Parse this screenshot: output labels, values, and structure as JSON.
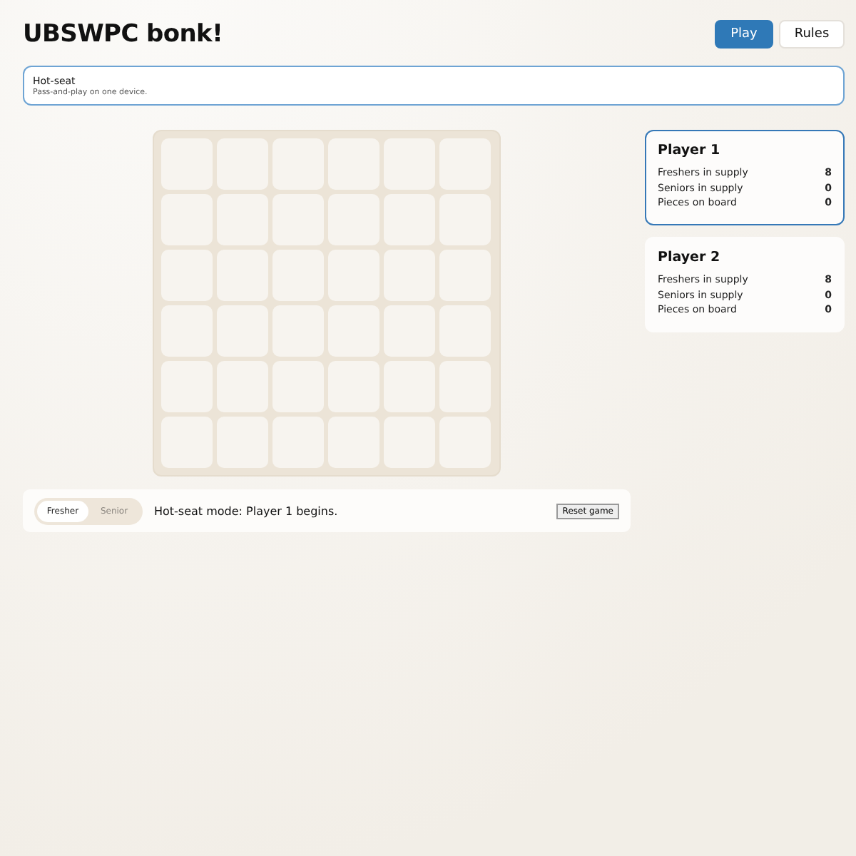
{
  "title": "UBSWPC bonk!",
  "nav": [
    {
      "label": "Play",
      "selected": true
    },
    {
      "label": "Rules",
      "selected": false
    }
  ],
  "mode": {
    "title": "Hot-seat",
    "description": "Pass-and-play on one device.",
    "selected": true
  },
  "board": {
    "rows": [
      [
        {
          "kind": "empty"
        },
        {
          "kind": "empty"
        },
        {
          "kind": "empty"
        },
        {
          "kind": "empty"
        },
        {
          "kind": "empty"
        },
        {
          "kind": "empty"
        }
      ],
      [
        {
          "kind": "empty"
        },
        {
          "kind": "empty"
        },
        {
          "kind": "empty"
        },
        {
          "kind": "empty"
        },
        {
          "kind": "empty"
        },
        {
          "kind": "empty"
        }
      ],
      [
        {
          "kind": "empty"
        },
        {
          "kind": "empty"
        },
        {
          "kind": "empty"
        },
        {
          "kind": "empty"
        },
        {
          "kind": "empty"
        },
        {
          "kind": "empty"
        }
      ],
      [
        {
          "kind": "empty"
        },
        {
          "kind": "empty"
        },
        {
          "kind": "empty"
        },
        {
          "kind": "empty"
        },
        {
          "kind": "empty"
        },
        {
          "kind": "empty"
        }
      ],
      [
        {
          "kind": "empty"
        },
        {
          "kind": "empty"
        },
        {
          "kind": "empty"
        },
        {
          "kind": "empty"
        },
        {
          "kind": "empty"
        },
        {
          "kind": "empty"
        }
      ],
      [
        {
          "kind": "empty"
        },
        {
          "kind": "empty"
        },
        {
          "kind": "empty"
        },
        {
          "kind": "empty"
        },
        {
          "kind": "empty"
        },
        {
          "kind": "empty"
        }
      ]
    ]
  },
  "piece_toggle": [
    {
      "label": "Fresher",
      "selected": true
    },
    {
      "label": "Senior",
      "selected": false
    }
  ],
  "status": "Hot-seat mode: Player 1 begins.",
  "reset_button": "Reset game",
  "players": [
    {
      "name": "Player 1",
      "selected": true,
      "stats": [
        {
          "label": "Freshers in supply",
          "value": "8"
        },
        {
          "label": "Seniors in supply",
          "value": "0"
        },
        {
          "label": "Pieces on board",
          "value": "0"
        }
      ]
    },
    {
      "name": "Player 2",
      "selected": false,
      "stats": [
        {
          "label": "Freshers in supply",
          "value": "8"
        },
        {
          "label": "Seniors in supply",
          "value": "0"
        },
        {
          "label": "Pieces on board",
          "value": "0"
        }
      ]
    }
  ]
}
